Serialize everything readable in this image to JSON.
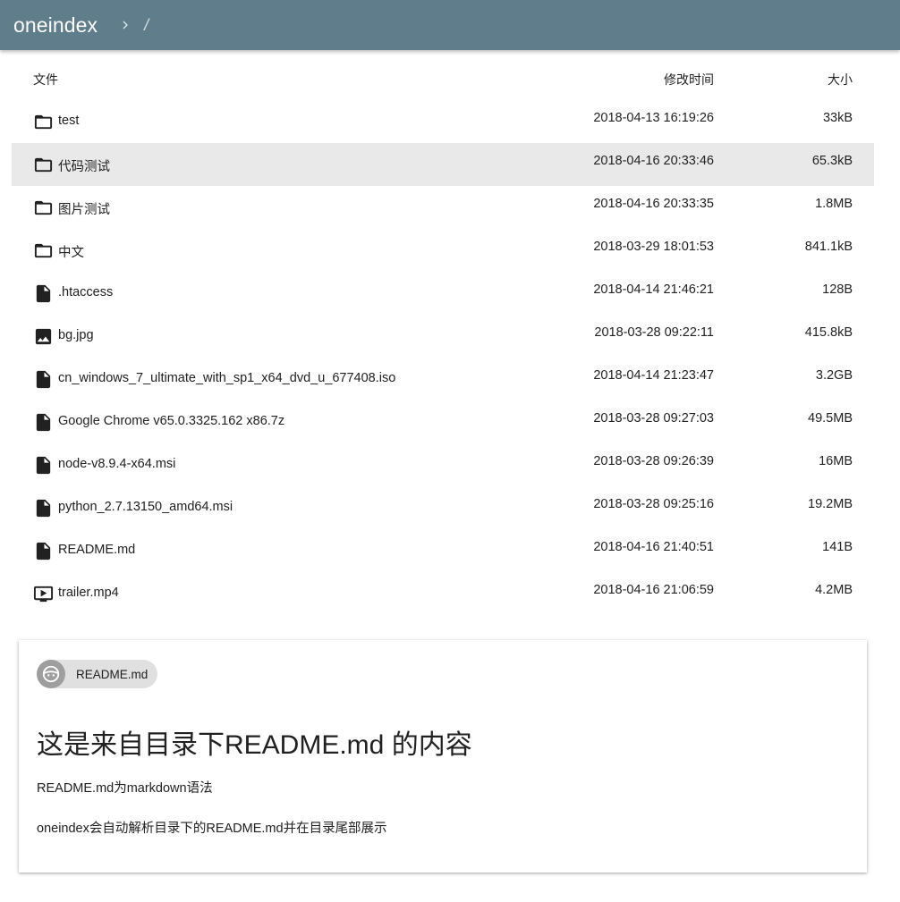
{
  "app": {
    "title": "oneindex",
    "breadcrumb_separator_icon": "chevron-right-icon",
    "breadcrumb_path": "/"
  },
  "colors": {
    "appbar": "#607d8b",
    "active_row": "#e9e9e9",
    "chip": "#e0e0e0",
    "chip_avatar": "#9e9e9e"
  },
  "list_header": {
    "name": "文件",
    "modified": "修改时间",
    "size": "大小"
  },
  "files": [
    {
      "icon": "folder-icon",
      "name": "test",
      "modified": "2018-04-13 16:19:26",
      "size": "33kB",
      "active": false
    },
    {
      "icon": "folder-icon",
      "name": "代码测试",
      "modified": "2018-04-16 20:33:46",
      "size": "65.3kB",
      "active": true
    },
    {
      "icon": "folder-icon",
      "name": "图片测试",
      "modified": "2018-04-16 20:33:35",
      "size": "1.8MB",
      "active": false
    },
    {
      "icon": "folder-icon",
      "name": "中文",
      "modified": "2018-03-29 18:01:53",
      "size": "841.1kB",
      "active": false
    },
    {
      "icon": "file-icon",
      "name": ".htaccess",
      "modified": "2018-04-14 21:46:21",
      "size": "128B",
      "active": false
    },
    {
      "icon": "image-icon",
      "name": "bg.jpg",
      "modified": "2018-03-28 09:22:11",
      "size": "415.8kB",
      "active": false
    },
    {
      "icon": "file-icon",
      "name": "cn_windows_7_ultimate_with_sp1_x64_dvd_u_677408.iso",
      "modified": "2018-04-14 21:23:47",
      "size": "3.2GB",
      "active": false
    },
    {
      "icon": "file-icon",
      "name": "Google Chrome v65.0.3325.162 x86.7z",
      "modified": "2018-03-28 09:27:03",
      "size": "49.5MB",
      "active": false
    },
    {
      "icon": "file-icon",
      "name": "node-v8.9.4-x64.msi",
      "modified": "2018-03-28 09:26:39",
      "size": "16MB",
      "active": false
    },
    {
      "icon": "file-icon",
      "name": "python_2.7.13150_amd64.msi",
      "modified": "2018-03-28 09:25:16",
      "size": "19.2MB",
      "active": false
    },
    {
      "icon": "file-icon",
      "name": "README.md",
      "modified": "2018-04-16 21:40:51",
      "size": "141B",
      "active": false
    },
    {
      "icon": "video-icon",
      "name": "trailer.mp4",
      "modified": "2018-04-16 21:06:59",
      "size": "4.2MB",
      "active": false
    }
  ],
  "readme": {
    "chip_icon": "face-icon",
    "chip_label": "README.md",
    "heading": "这是来自目录下README.md 的内容",
    "paragraph1": "README.md为markdown语法",
    "paragraph2": "oneindex会自动解析目录下的README.md并在目录尾部展示"
  }
}
